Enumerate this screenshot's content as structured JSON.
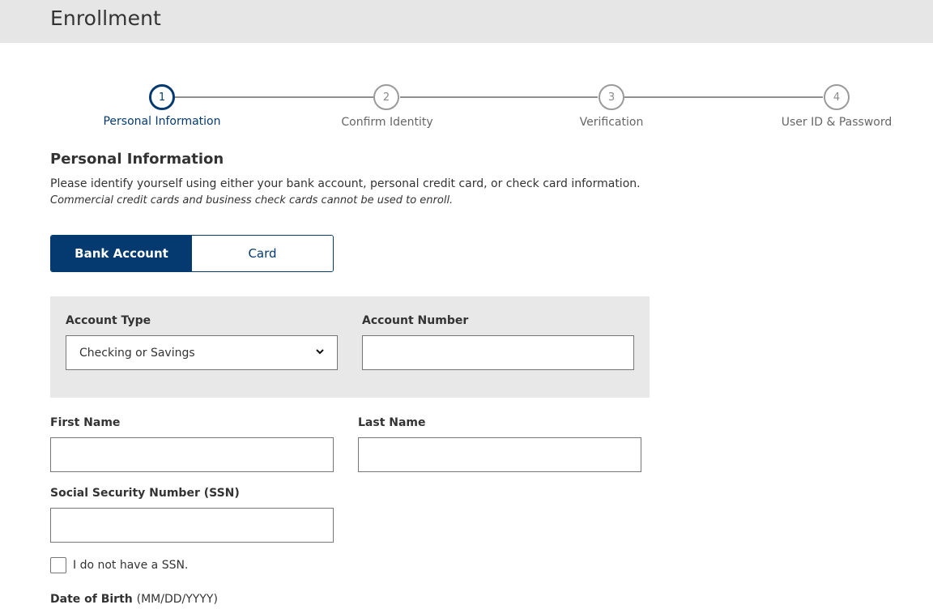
{
  "header": {
    "title": "Enrollment"
  },
  "steps": [
    {
      "number": "1",
      "label": "Personal Information"
    },
    {
      "number": "2",
      "label": "Confirm Identity"
    },
    {
      "number": "3",
      "label": "Verification"
    },
    {
      "number": "4",
      "label": "User ID & Password"
    }
  ],
  "section": {
    "title": "Personal Information",
    "intro": "Please identify yourself using either your bank account, personal credit card, or check card information.",
    "note": "Commercial credit cards and business check cards cannot be used to enroll."
  },
  "toggle": {
    "bank_account": "Bank Account",
    "card": "Card"
  },
  "account": {
    "type_label": "Account Type",
    "type_value": "Checking or Savings",
    "number_label": "Account Number"
  },
  "person": {
    "first_name_label": "First Name",
    "last_name_label": "Last Name",
    "ssn_label": "Social Security Number (SSN)",
    "no_ssn_label": "I do not have a SSN.",
    "dob_label": "Date of Birth",
    "dob_hint": "(MM/DD/YYYY)"
  },
  "colors": {
    "primary": "#043a6f",
    "header_bg": "#e6e6e6",
    "panel_bg": "#e8e8e8"
  }
}
